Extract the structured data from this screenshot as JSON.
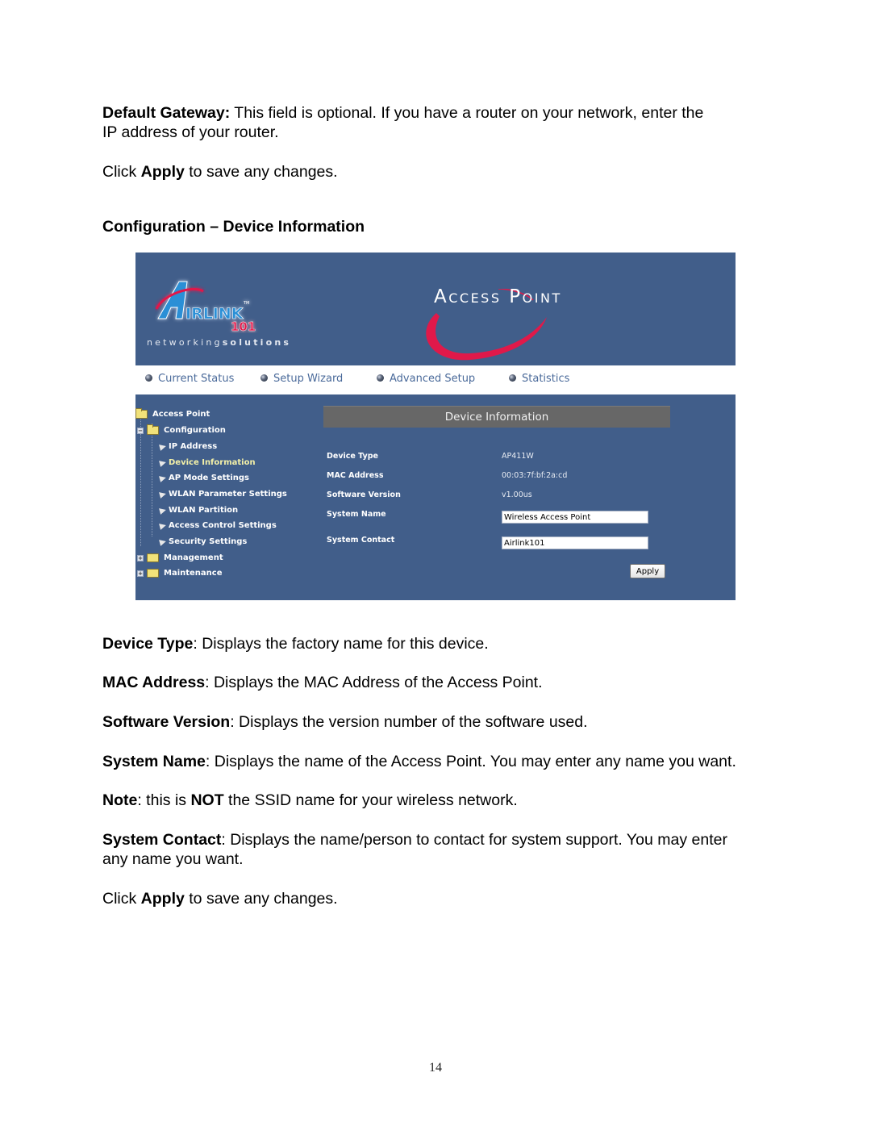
{
  "document": {
    "default_gateway": {
      "term": "Default Gateway:",
      "text_line1": " This field is optional. If you have a router on your network, enter the",
      "text_line2": "IP address of your router."
    },
    "apply_note_1": {
      "prefix": "Click ",
      "bold": "Apply",
      "suffix": " to save any changes."
    },
    "section_heading": "Configuration – Device Information",
    "descriptions": [
      {
        "term": "Device Type",
        "text": ": Displays the factory name for this device."
      },
      {
        "term": "MAC Address",
        "text": ": Displays the MAC Address of the Access Point."
      },
      {
        "term": "Software Version",
        "text": ": Displays the version number of the software used."
      },
      {
        "term": "System Name",
        "text": ": Displays the name of the Access Point. You may enter any name you want."
      },
      {
        "term": "System Contact",
        "text": ": Displays the name/person to contact for system support. You may enter any name you want."
      }
    ],
    "note": {
      "term": "Note",
      "text_a": ": this is ",
      "bold": "NOT",
      "text_b": " the SSID name for your wireless network."
    },
    "apply_note_2": {
      "prefix": "Click ",
      "bold": "Apply",
      "suffix": " to save any changes."
    },
    "page_number": "14"
  },
  "screenshot": {
    "brand": {
      "logo_text": "AIRLINK",
      "logo_number": "101",
      "logo_tm": "TM",
      "tagline_light": "networking",
      "tagline_bold": "solutions",
      "product_title": "Access Point"
    },
    "colors": {
      "banner": "#415e8a",
      "accent_red": "#e0194a",
      "section_bar": "#676767",
      "active_item": "#f3f0a8"
    },
    "nav": [
      {
        "label": "Current Status",
        "icon": "bullet-icon"
      },
      {
        "label": "Setup Wizard",
        "icon": "bullet-icon"
      },
      {
        "label": "Advanced Setup",
        "icon": "bullet-icon"
      },
      {
        "label": "Statistics",
        "icon": "bullet-icon"
      }
    ],
    "tree": {
      "root": "Access Point",
      "configuration": "Configuration",
      "children": [
        {
          "label": "IP Address",
          "active": false
        },
        {
          "label": "Device Information",
          "active": true
        },
        {
          "label": "AP Mode Settings",
          "active": false
        },
        {
          "label": "WLAN  Parameter Settings",
          "active": false
        },
        {
          "label": "WLAN  Partition",
          "active": false
        },
        {
          "label": "Access Control Settings",
          "active": false
        },
        {
          "label": "Security Settings",
          "active": false
        }
      ],
      "management": "Management",
      "maintenance": "Maintenance"
    },
    "form": {
      "title": "Device Information",
      "device_type_label": "Device Type",
      "device_type_value": "AP411W",
      "mac_label": "MAC Address",
      "mac_value": "00:03:7f:bf:2a:cd",
      "software_label": "Software Version",
      "software_value": "v1.00us",
      "system_name_label": "System Name",
      "system_name_value": "Wireless Access Point",
      "system_contact_label": "System Contact",
      "system_contact_value": "Airlink101",
      "apply_label": "Apply"
    }
  }
}
